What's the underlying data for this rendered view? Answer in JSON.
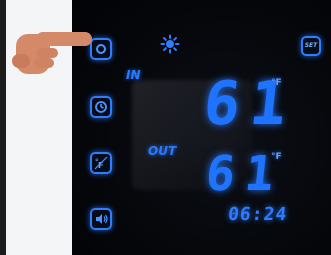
{
  "display": {
    "in_label": "IN",
    "out_label": "OUT",
    "indoor_temp": "61",
    "outdoor_temp": "61",
    "temp_unit": "°F",
    "time": "06:24"
  },
  "buttons": {
    "set_label": "SET"
  },
  "icons": {
    "top_left": "power-icon",
    "clock": "clock-icon",
    "unit_toggle": "celsius-fahrenheit-icon",
    "sound": "speaker-icon",
    "brightness": "sun-icon",
    "pointer": "pointing-hand-icon"
  },
  "colors": {
    "segment_blue": "#1f74ff",
    "button_blue": "#2f7cff",
    "panel_black": "#05070b",
    "background_white": "#f4f5f6",
    "hand_skin": "#d48a69"
  }
}
